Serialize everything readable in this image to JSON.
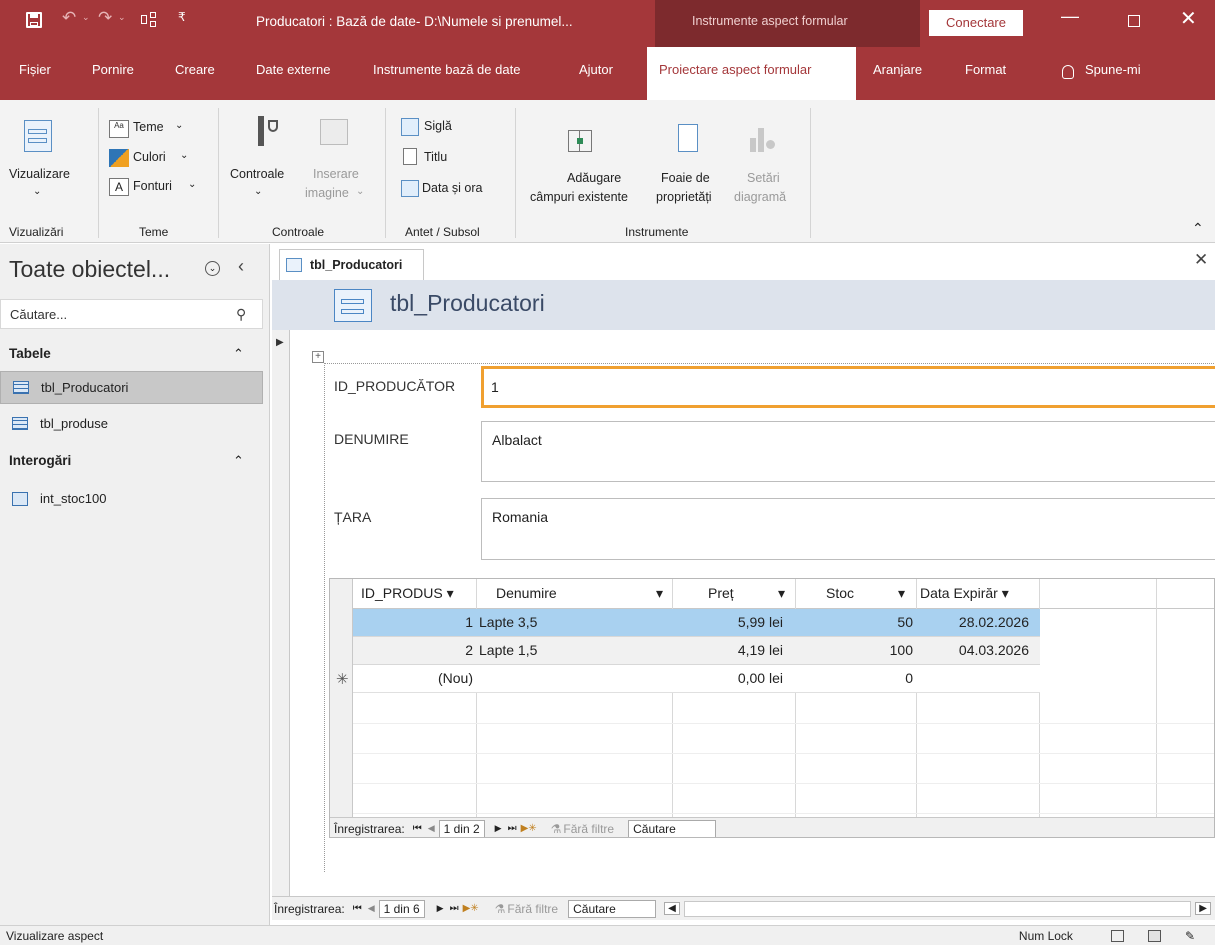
{
  "titlebar": {
    "title": "Producatori : Bază de date- D:\\Numele si prenumel...",
    "context_tab": "Instrumente aspect formular",
    "signin": "Conectare"
  },
  "tabs": [
    "Fișier",
    "Pornire",
    "Creare",
    "Date externe",
    "Instrumente bază de date",
    "Ajutor",
    "Proiectare aspect formular",
    "Aranjare",
    "Format",
    "Spune-mi"
  ],
  "ribbon": {
    "view_label": "Vizualizare",
    "themes": [
      "Teme",
      "Culori",
      "Fonturi"
    ],
    "controls_label": "Controale",
    "insert_image_label1": "Inserare",
    "insert_image_label2": "imagine",
    "header_items": [
      "Siglă",
      "Titlu",
      "Data și ora"
    ],
    "add_fields1": "Adăugare",
    "add_fields2": "câmpuri existente",
    "property_sheet1": "Foaie de",
    "property_sheet2": "proprietăți",
    "chart_settings1": "Setări",
    "chart_settings2": "diagramă",
    "groups": [
      "Vizualizări",
      "Teme",
      "Controale",
      "Antet / Subsol",
      "Instrumente"
    ]
  },
  "nav": {
    "title": "Toate obiectel...",
    "search_placeholder": "Căutare...",
    "section_tables": "Tabele",
    "tables": [
      "tbl_Producatori",
      "tbl_produse"
    ],
    "section_queries": "Interogări",
    "queries": [
      "int_stoc100"
    ]
  },
  "doc": {
    "tab_name": "tbl_Producatori",
    "form_title": "tbl_Producatori",
    "fields": [
      {
        "label": "ID_PRODUCĂTOR",
        "value": "1"
      },
      {
        "label": "DENUMIRE",
        "value": "Albalact"
      },
      {
        "label": "ȚARA",
        "value": "Romania"
      }
    ]
  },
  "subform": {
    "columns": [
      "ID_PRODUS",
      "Denumire",
      "Preț",
      "Stoc",
      "Data Expirăr"
    ],
    "rows": [
      {
        "id": "1",
        "denumire": "Lapte 3,5",
        "pret": "5,99 lei",
        "stoc": "50",
        "data": "28.02.2026"
      },
      {
        "id": "2",
        "denumire": "Lapte 1,5",
        "pret": "4,19 lei",
        "stoc": "100",
        "data": "04.03.2026"
      }
    ],
    "new_row": {
      "id": "(Nou)",
      "pret": "0,00 lei",
      "stoc": "0"
    },
    "nav_label": "Înregistrarea:",
    "position": "1 din 2",
    "filter": "Fără filtre",
    "search": "Căutare"
  },
  "mainnav": {
    "nav_label": "Înregistrarea:",
    "position": "1 din 6",
    "filter": "Fără filtre",
    "search": "Căutare"
  },
  "status": {
    "left": "Vizualizare aspect",
    "numlock": "Num Lock"
  },
  "colors": {
    "accent": "#a4373a",
    "accent_dark": "#7d2a2d",
    "selection": "#a9d1f0",
    "focus_border": "#f0a030"
  }
}
